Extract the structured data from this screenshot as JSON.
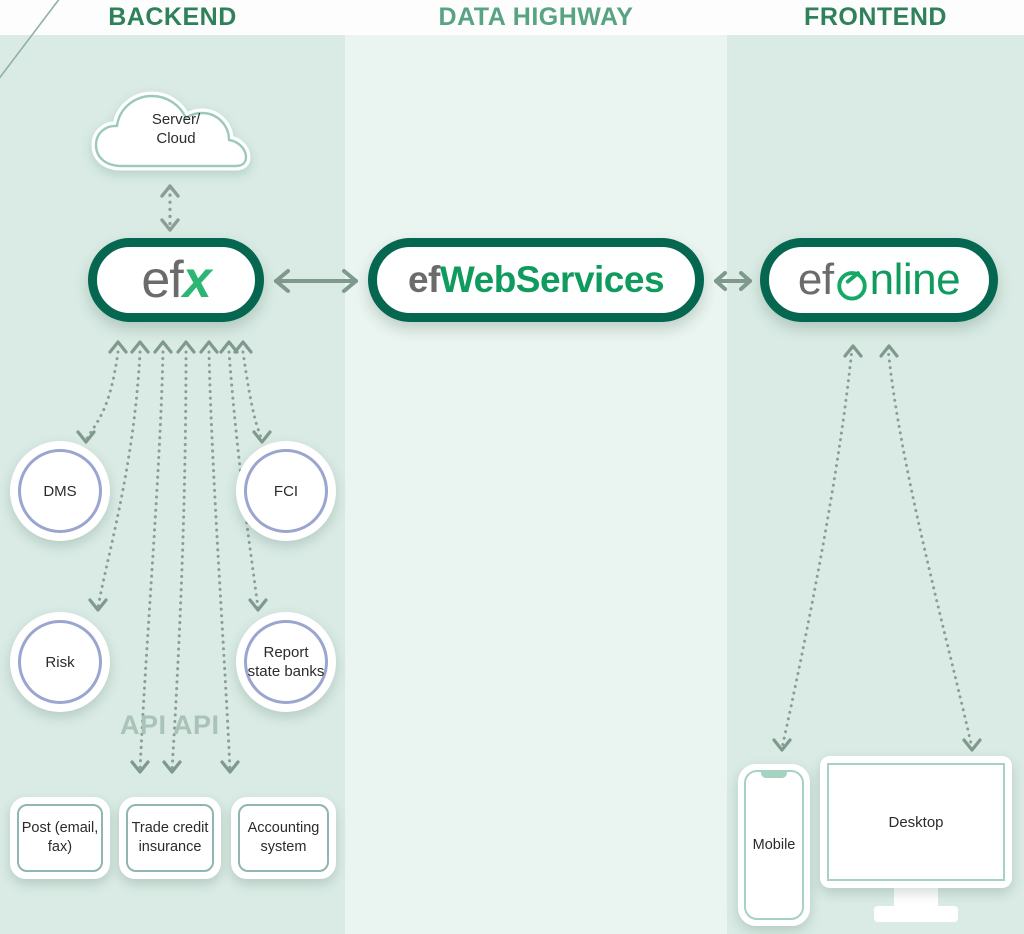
{
  "columns": [
    {
      "id": "backend",
      "title": "BACKEND"
    },
    {
      "id": "highway",
      "title": "DATA HIGHWAY"
    },
    {
      "id": "frontend",
      "title": "FRONTEND"
    }
  ],
  "backend": {
    "cloud": {
      "label_line1": "Server/",
      "label_line2": "Cloud",
      "icon": "cloud-icon"
    },
    "platform": {
      "prefix": "ef",
      "suffix": "x",
      "name": "efX"
    },
    "circles": [
      {
        "id": "dms",
        "label": "DMS"
      },
      {
        "id": "fci",
        "label": "FCI"
      },
      {
        "id": "risk",
        "label": "Risk"
      },
      {
        "id": "report",
        "label": "Report state banks"
      }
    ],
    "boxes": [
      {
        "id": "post",
        "label": "Post (email, fax)"
      },
      {
        "id": "trade-credit-insurance",
        "label": "Trade credit insurance"
      },
      {
        "id": "accounting-system",
        "label": "Accounting system"
      }
    ],
    "api_labels": [
      "API",
      "API"
    ]
  },
  "highway": {
    "service": {
      "prefix": "ef",
      "suffix": "WebServices",
      "name": "efWebServices"
    }
  },
  "frontend": {
    "portal": {
      "prefix": "ef",
      "middle": "O",
      "suffix": "nline",
      "name": "efOnline"
    },
    "devices": [
      {
        "id": "mobile",
        "label": "Mobile"
      },
      {
        "id": "desktop",
        "label": "Desktop"
      }
    ]
  },
  "connectors": {
    "efx_to_webservices": "bidirectional-arrow",
    "webservices_to_efonline": "bidirectional-arrow",
    "cloud_to_efx": "bidirectional-dotted-arrow"
  },
  "colors": {
    "brand_dark_green": "#05674f",
    "brand_green": "#16a866",
    "band_tint": "#d9ebe4",
    "band_light": "#eaf4f0",
    "header_text": "#2f8159",
    "circle_border": "#9aa6cf",
    "box_border": "#8fb6b2",
    "arrow": "#7f9a8d",
    "api_text": "#a9c3b8"
  }
}
